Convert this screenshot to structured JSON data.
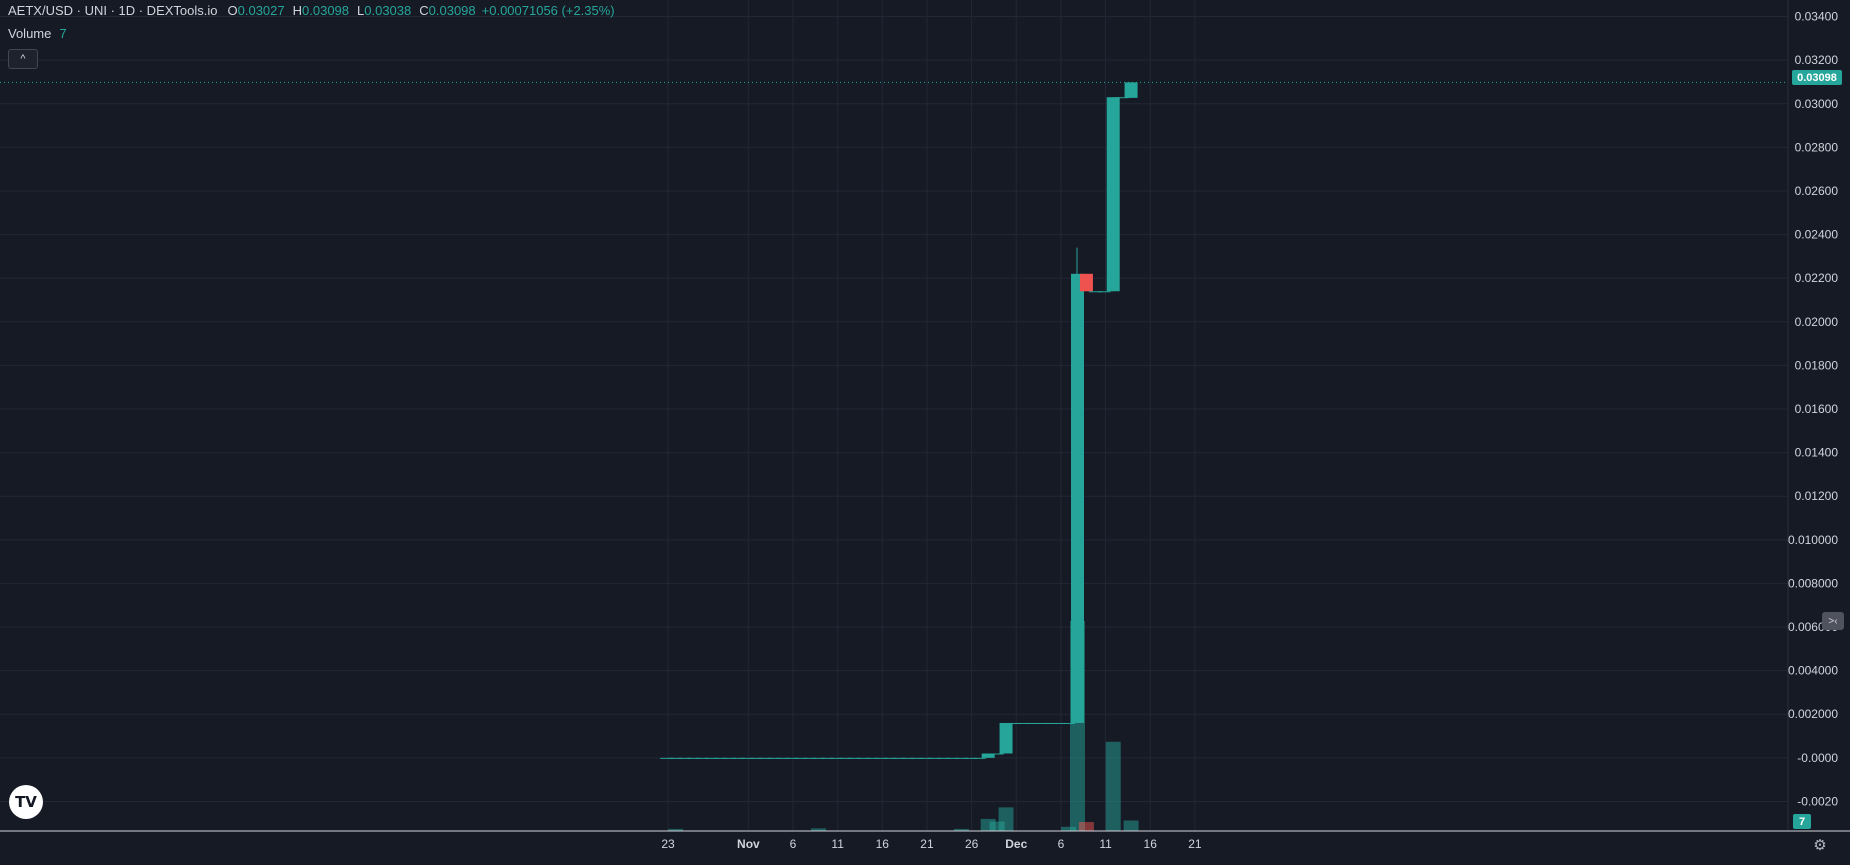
{
  "legend": {
    "title": "AETX/USD · UNI · 1D · DEXTools.io",
    "open_label": "O",
    "open": "0.03027",
    "high_label": "H",
    "high": "0.03098",
    "low_label": "L",
    "low": "0.03038",
    "close_label": "C",
    "close": "0.03098",
    "change": "+0.00071056 (+2.35%)",
    "volume_label": "Volume",
    "volume_value": "7"
  },
  "buttons": {
    "collapse": "^",
    "logo": "TV",
    "scale_toggle": ">‹",
    "settings": "⚙"
  },
  "colors": {
    "up": "#26a69a",
    "down": "#ef5350",
    "background": "#161a25",
    "grid": "#232735",
    "axis_text": "#d1d4dc"
  },
  "last_price_tag": "0.03098",
  "volume_tag": "7",
  "chart_data": {
    "type": "candlestick",
    "y_ticks": [
      "0.03400",
      "0.03200",
      "0.03000",
      "0.02800",
      "0.02600",
      "0.02400",
      "0.02200",
      "0.02000",
      "0.01800",
      "0.01600",
      "0.01400",
      "0.01200",
      "0.010000",
      "0.008000",
      "0.006000",
      "0.004000",
      "0.002000",
      "-0.0000",
      "-0.0020"
    ],
    "ylim": [
      -0.0023,
      0.0343
    ],
    "x_ticks": [
      {
        "label": "23",
        "day": 0
      },
      {
        "label": "Nov",
        "day": 9
      },
      {
        "label": "6",
        "day": 14
      },
      {
        "label": "11",
        "day": 19
      },
      {
        "label": "16",
        "day": 24
      },
      {
        "label": "21",
        "day": 29
      },
      {
        "label": "26",
        "day": 34
      },
      {
        "label": "Dec",
        "day": 39
      },
      {
        "label": "6",
        "day": 44
      },
      {
        "label": "11",
        "day": 49
      },
      {
        "label": "16",
        "day": 54
      },
      {
        "label": "21",
        "day": 59
      }
    ],
    "last_price": 0.03098,
    "candles": [
      {
        "day": -0.2,
        "o": 0.0,
        "h": 0.0,
        "l": 0.0,
        "c": 0.0
      },
      {
        "day": 0.8,
        "o": 0.0,
        "h": 0.0,
        "l": 0.0,
        "c": 0.0
      },
      {
        "day": 1.8,
        "o": 0.0,
        "h": 0.0,
        "l": 0.0,
        "c": 0.0
      },
      {
        "day": 2.8,
        "o": 0.0,
        "h": 0.0,
        "l": 0.0,
        "c": 0.0
      },
      {
        "day": 3.8,
        "o": 0.0,
        "h": 0.0,
        "l": 0.0,
        "c": 0.0
      },
      {
        "day": 4.8,
        "o": 0.0,
        "h": 0.0,
        "l": 0.0,
        "c": 0.0
      },
      {
        "day": 5.8,
        "o": 0.0,
        "h": 0.0,
        "l": 0.0,
        "c": 0.0
      },
      {
        "day": 6.8,
        "o": 0.0,
        "h": 0.0,
        "l": 0.0,
        "c": 0.0
      },
      {
        "day": 7.8,
        "o": 0.0,
        "h": 0.0,
        "l": 0.0,
        "c": 0.0
      },
      {
        "day": 8.8,
        "o": 0.0,
        "h": 0.0,
        "l": 0.0,
        "c": 0.0
      },
      {
        "day": 9.8,
        "o": 0.0,
        "h": 0.0,
        "l": 0.0,
        "c": 0.0
      },
      {
        "day": 10.8,
        "o": 0.0,
        "h": 0.0,
        "l": 0.0,
        "c": 0.0
      },
      {
        "day": 11.8,
        "o": 0.0,
        "h": 0.0,
        "l": 0.0,
        "c": 0.0
      },
      {
        "day": 12.8,
        "o": 0.0,
        "h": 0.0,
        "l": 0.0,
        "c": 0.0
      },
      {
        "day": 13.8,
        "o": 0.0,
        "h": 0.0,
        "l": 0.0,
        "c": 0.0
      },
      {
        "day": 14.8,
        "o": 0.0,
        "h": 0.0,
        "l": 0.0,
        "c": 0.0
      },
      {
        "day": 15.8,
        "o": 0.0,
        "h": 0.0,
        "l": 0.0,
        "c": 0.0
      },
      {
        "day": 16.8,
        "o": 0.0,
        "h": 0.0,
        "l": 0.0,
        "c": 0.0
      },
      {
        "day": 17.8,
        "o": 0.0,
        "h": 0.0,
        "l": 0.0,
        "c": 0.0
      },
      {
        "day": 18.8,
        "o": 0.0,
        "h": 0.0,
        "l": 0.0,
        "c": 0.0
      },
      {
        "day": 19.8,
        "o": 0.0,
        "h": 0.0,
        "l": 0.0,
        "c": 0.0
      },
      {
        "day": 20.8,
        "o": 0.0,
        "h": 0.0,
        "l": 0.0,
        "c": 0.0
      },
      {
        "day": 21.8,
        "o": 0.0,
        "h": 0.0,
        "l": 0.0,
        "c": 0.0
      },
      {
        "day": 22.8,
        "o": 0.0,
        "h": 0.0,
        "l": 0.0,
        "c": 0.0
      },
      {
        "day": 23.8,
        "o": 0.0,
        "h": 0.0,
        "l": 0.0,
        "c": 0.0
      },
      {
        "day": 24.8,
        "o": 0.0,
        "h": 0.0,
        "l": 0.0,
        "c": 0.0
      },
      {
        "day": 25.8,
        "o": 0.0,
        "h": 0.0,
        "l": 0.0,
        "c": 0.0
      },
      {
        "day": 26.8,
        "o": 0.0,
        "h": 0.0,
        "l": 0.0,
        "c": 0.0
      },
      {
        "day": 27.8,
        "o": 0.0,
        "h": 0.0,
        "l": 0.0,
        "c": 0.0
      },
      {
        "day": 28.8,
        "o": 0.0,
        "h": 0.0,
        "l": 0.0,
        "c": 0.0
      },
      {
        "day": 29.8,
        "o": 0.0,
        "h": 0.0,
        "l": 0.0,
        "c": 0.0
      },
      {
        "day": 30.8,
        "o": 0.0,
        "h": 0.0,
        "l": 0.0,
        "c": 0.0
      },
      {
        "day": 31.8,
        "o": 0.0,
        "h": 0.0,
        "l": 0.0,
        "c": 0.0
      },
      {
        "day": 32.8,
        "o": 0.0,
        "h": 0.0,
        "l": 0.0,
        "c": 0.0
      },
      {
        "day": 33.8,
        "o": 0.0,
        "h": 0.0,
        "l": 0.0,
        "c": 0.0
      },
      {
        "day": 34.8,
        "o": 0.0,
        "h": 0.0,
        "l": 0.0,
        "c": 0.0
      },
      {
        "day": 35.8,
        "o": 0.0,
        "h": 0.0002,
        "l": 0.0,
        "c": 0.0002
      },
      {
        "day": 36.8,
        "o": 0.0002,
        "h": 0.0002,
        "l": 0.0002,
        "c": 0.0002
      },
      {
        "day": 37.8,
        "o": 0.0002,
        "h": 0.0016,
        "l": 0.0002,
        "c": 0.0016
      },
      {
        "day": 38.8,
        "o": 0.0016,
        "h": 0.0016,
        "l": 0.0016,
        "c": 0.0016
      },
      {
        "day": 39.8,
        "o": 0.0016,
        "h": 0.0016,
        "l": 0.0016,
        "c": 0.0016
      },
      {
        "day": 40.8,
        "o": 0.0016,
        "h": 0.0016,
        "l": 0.0016,
        "c": 0.0016
      },
      {
        "day": 41.8,
        "o": 0.0016,
        "h": 0.0016,
        "l": 0.0016,
        "c": 0.0016
      },
      {
        "day": 42.8,
        "o": 0.0016,
        "h": 0.0016,
        "l": 0.0016,
        "c": 0.0016
      },
      {
        "day": 43.8,
        "o": 0.0016,
        "h": 0.0016,
        "l": 0.0016,
        "c": 0.0016
      },
      {
        "day": 44.8,
        "o": 0.0016,
        "h": 0.0016,
        "l": 0.0016,
        "c": 0.0016
      },
      {
        "day": 45.8,
        "o": 0.0016,
        "h": 0.0234,
        "l": 0.0016,
        "c": 0.0222
      },
      {
        "day": 46.8,
        "o": 0.0222,
        "h": 0.0222,
        "l": 0.0214,
        "c": 0.0214
      },
      {
        "day": 47.8,
        "o": 0.0214,
        "h": 0.0214,
        "l": 0.0214,
        "c": 0.0214
      },
      {
        "day": 48.8,
        "o": 0.0214,
        "h": 0.0214,
        "l": 0.0214,
        "c": 0.0214
      },
      {
        "day": 49.8,
        "o": 0.0214,
        "h": 0.0303,
        "l": 0.0214,
        "c": 0.0303
      },
      {
        "day": 50.8,
        "o": 0.0303,
        "h": 0.0303,
        "l": 0.0303,
        "c": 0.0303
      },
      {
        "day": 51.8,
        "o": 0.03027,
        "h": 0.03098,
        "l": 0.03027,
        "c": 0.03098
      }
    ],
    "volume": [
      {
        "day": 0.8,
        "v": 0.4,
        "dir": "up"
      },
      {
        "day": 16.8,
        "v": 0.5,
        "dir": "up"
      },
      {
        "day": 32.8,
        "v": 0.4,
        "dir": "up"
      },
      {
        "day": 35.8,
        "v": 2.3,
        "dir": "up"
      },
      {
        "day": 36.8,
        "v": 1.8,
        "dir": "up"
      },
      {
        "day": 37.8,
        "v": 4.5,
        "dir": "up"
      },
      {
        "day": 44.8,
        "v": 0.8,
        "dir": "up"
      },
      {
        "day": 45.8,
        "v": 40,
        "dir": "up"
      },
      {
        "day": 46.8,
        "v": 1.7,
        "dir": "down"
      },
      {
        "day": 49.8,
        "v": 17,
        "dir": "up"
      },
      {
        "day": 51.8,
        "v": 2.0,
        "dir": "up"
      }
    ],
    "volume_max": 40
  }
}
